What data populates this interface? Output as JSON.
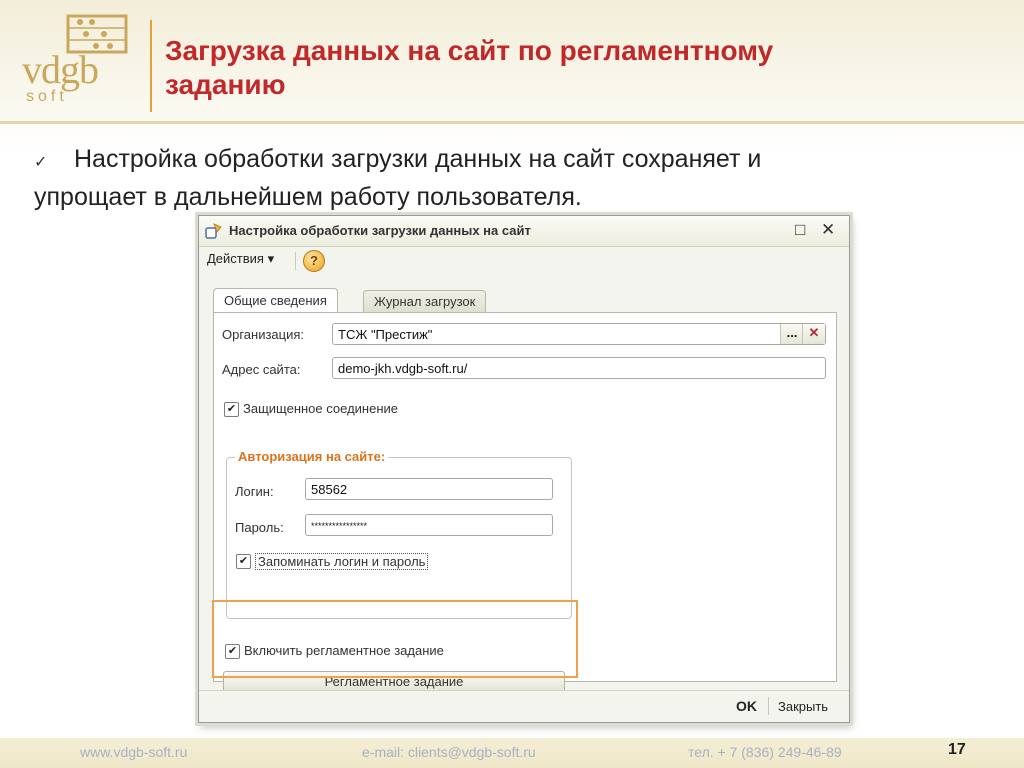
{
  "slide": {
    "logo_main": "vdgb",
    "logo_sub": "soft",
    "title_line1": "Загрузка данных на сайт по регламентному",
    "title_line2": "заданию",
    "bullet_mark": "✓",
    "bullet_line1": "Настройка   обработки загрузки данных на сайт сохраняет  и",
    "bullet_line2": "упрощает в дальнейшем работу пользователя.",
    "accent_color": "#c0282a",
    "highlight_color": "#f0a14a"
  },
  "window": {
    "title": "Настройка обработки загрузки данных на сайт",
    "maximize_icon": "□",
    "close_icon": "✕",
    "actions_menu": "Действия",
    "actions_arrow": "▾",
    "help_label": "?",
    "tabs": [
      {
        "label": "Общие сведения",
        "active": true
      },
      {
        "label": "Журнал загрузок",
        "active": false
      }
    ],
    "form": {
      "organization_label": "Организация:",
      "organization_value": "ТСЖ \"Престиж\"",
      "choose_button": "...",
      "clear_button": "✕",
      "site_label": "Адрес сайта:",
      "site_value": "demo-jkh.vdgb-soft.ru/",
      "secure_label": "Защищенное соединение",
      "secure_checked": true,
      "auth_group_title": "Авторизация на сайте:",
      "login_label": "Логин:",
      "login_value": "58562",
      "password_label": "Пароль:",
      "password_value": "****************",
      "remember_label": "Запоминать логин и пароль",
      "remember_checked": true,
      "schedule_enable_label": "Включить регламентное задание",
      "schedule_enable_checked": true,
      "schedule_button": "Регламентное задание"
    },
    "ok_button": "OK",
    "close_button": "Закрыть"
  },
  "footer": {
    "site": "www.vdgb-soft.ru",
    "email": "e-mail: clients@vdgb-soft.ru",
    "phone": "тел. + 7 (836) 249-46-89",
    "page": "17"
  }
}
